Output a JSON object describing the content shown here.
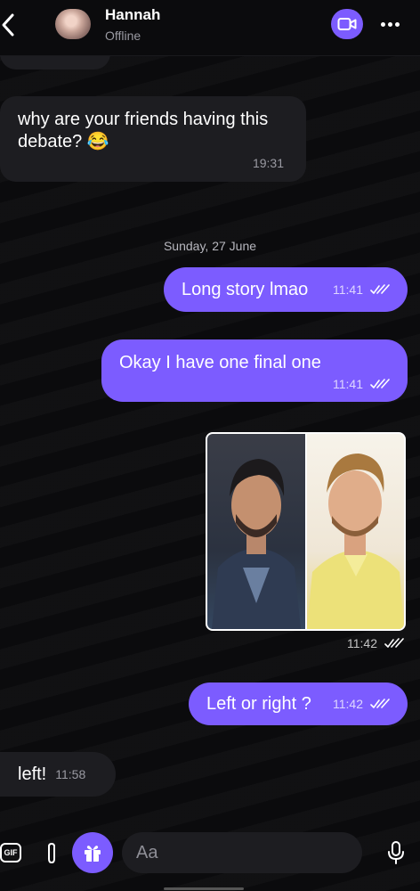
{
  "header": {
    "contact_name": "Hannah",
    "contact_status": "Offline",
    "icons": {
      "back": "chevron-left-icon",
      "video": "video-camera-icon",
      "more": "more-dots-icon"
    }
  },
  "colors": {
    "accent": "#7c5cff",
    "incoming_bubble": "#1d1d21",
    "background": "#0b0b0d"
  },
  "messages": [
    {
      "direction": "in",
      "text": "why are your friends having this debate? 😂",
      "time": "19:31"
    },
    {
      "type": "date_separator",
      "text": "Sunday, 27 June"
    },
    {
      "direction": "out",
      "text": "Long story lmao",
      "time": "11:41",
      "status": "read"
    },
    {
      "direction": "out",
      "text": "Okay I have one final one",
      "time": "11:41",
      "status": "read"
    },
    {
      "direction": "out",
      "type": "image",
      "time": "11:42",
      "status": "read"
    },
    {
      "direction": "out",
      "text": "Left or right ?",
      "time": "11:42",
      "status": "read"
    },
    {
      "direction": "in",
      "text": "left!",
      "time": "11:58"
    }
  ],
  "composer": {
    "gif_label": "GIF",
    "placeholder": "Aa",
    "icons": {
      "attach": "paperclip-icon",
      "gift": "gift-icon",
      "mic": "microphone-icon"
    }
  }
}
